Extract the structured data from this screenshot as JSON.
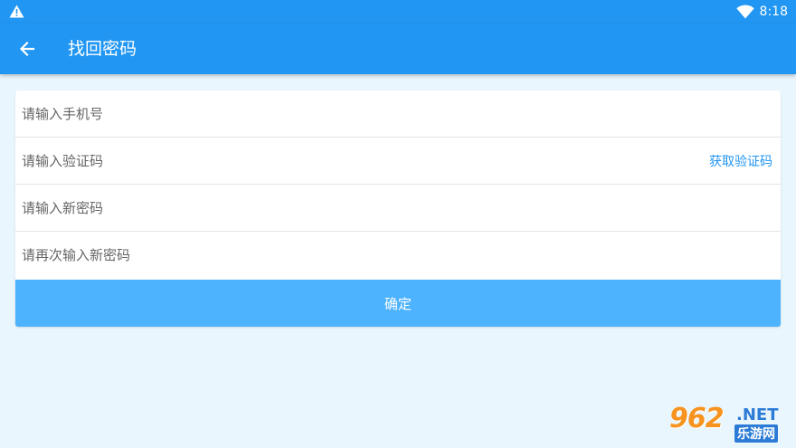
{
  "status_bar": {
    "time": "8:18",
    "warning_icon": "warning-icon",
    "wifi_icon": "wifi-icon"
  },
  "app_bar": {
    "back_icon": "arrow-left-icon",
    "title": "找回密码"
  },
  "form": {
    "phone_placeholder": "请输入手机号",
    "code_placeholder": "请输入验证码",
    "get_code_label": "获取验证码",
    "new_password_placeholder": "请输入新密码",
    "confirm_password_placeholder": "请再次输入新密码",
    "confirm_label": "确定"
  },
  "colors": {
    "primary": "#2196f3",
    "button": "#4db3ff",
    "background": "#eaf6fd"
  },
  "watermark": {
    "number": "962",
    "suffix": ".NET",
    "site_name": "乐游网"
  }
}
